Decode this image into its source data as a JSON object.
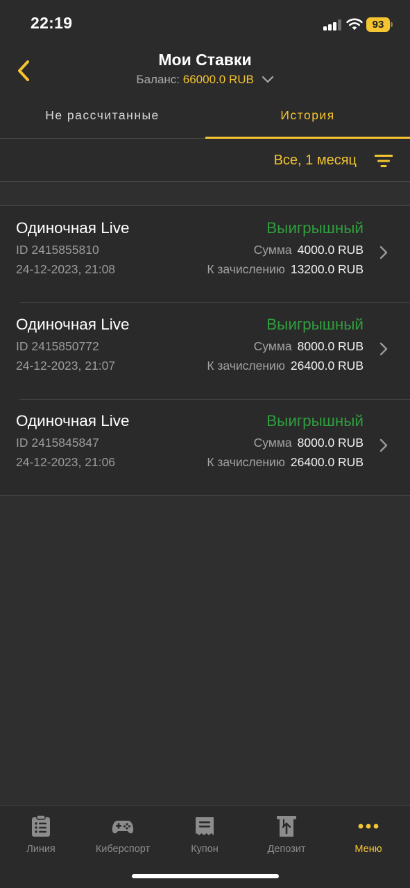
{
  "status_bar": {
    "time": "22:19",
    "battery": "93"
  },
  "header": {
    "title": "Мои Ставки",
    "balance_label": "Баланс:",
    "balance_value": "66000.0 RUB"
  },
  "tabs": [
    {
      "label": "Не рассчитанные",
      "active": false
    },
    {
      "label": "История",
      "active": true
    }
  ],
  "filter": {
    "label": "Все, 1 месяц"
  },
  "bets": [
    {
      "type": "Одиночная Live",
      "id": "ID 2415855810",
      "date": "24-12-2023, 21:08",
      "status": "Выигрышный",
      "sum_label": "Сумма",
      "sum": "4000.0 RUB",
      "payout_label": "К зачислению",
      "payout": "13200.0 RUB"
    },
    {
      "type": "Одиночная Live",
      "id": "ID 2415850772",
      "date": "24-12-2023, 21:07",
      "status": "Выигрышный",
      "sum_label": "Сумма",
      "sum": "8000.0 RUB",
      "payout_label": "К зачислению",
      "payout": "26400.0 RUB"
    },
    {
      "type": "Одиночная Live",
      "id": "ID 2415845847",
      "date": "24-12-2023, 21:06",
      "status": "Выигрышный",
      "sum_label": "Сумма",
      "sum": "8000.0 RUB",
      "payout_label": "К зачислению",
      "payout": "26400.0 RUB"
    }
  ],
  "bottom_nav": [
    {
      "label": "Линия",
      "icon": "clipboard-list-icon",
      "active": false
    },
    {
      "label": "Киберспорт",
      "icon": "gamepad-icon",
      "active": false
    },
    {
      "label": "Купон",
      "icon": "coupon-icon",
      "active": false
    },
    {
      "label": "Депозит",
      "icon": "deposit-icon",
      "active": false
    },
    {
      "label": "Меню",
      "icon": "more-dots-icon",
      "active": true
    }
  ],
  "colors": {
    "accent": "#f5c531",
    "win": "#2f9e3e",
    "background": "#2f2f2f",
    "panel": "#2a2a2a"
  }
}
